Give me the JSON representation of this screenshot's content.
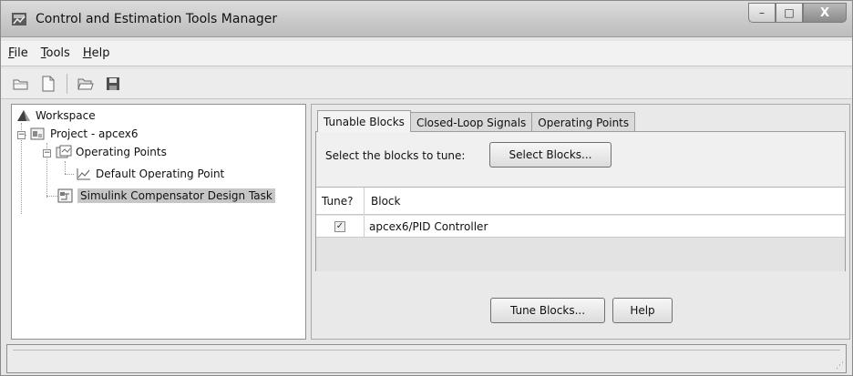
{
  "window": {
    "title": "Control and Estimation Tools Manager",
    "minimize": "–",
    "maximize": "□",
    "close": "X"
  },
  "menu": [
    {
      "label": "File",
      "accel": "F",
      "rest": "ile"
    },
    {
      "label": "Tools",
      "accel": "T",
      "rest": "ools"
    },
    {
      "label": "Help",
      "accel": "H",
      "rest": "elp"
    }
  ],
  "toolbar": {
    "icons": [
      "open-project-icon",
      "new-document-icon",
      "open-folder-icon",
      "save-icon"
    ]
  },
  "tree": {
    "workspace": "Workspace",
    "project": "Project - apcex6",
    "operating_points": "Operating Points",
    "default_op": "Default Operating Point",
    "task": "Simulink Compensator Design Task"
  },
  "tabs": {
    "tunable": "Tunable Blocks",
    "closed_loop": "Closed-Loop Signals",
    "operating": "Operating Points"
  },
  "tunable": {
    "select_label": "Select the blocks to tune:",
    "select_button": "Select Blocks...",
    "col_tune": "Tune?",
    "col_block": "Block",
    "rows": [
      {
        "checked": true,
        "check_glyph": "✓",
        "block": "apcex6/PID Controller"
      }
    ]
  },
  "buttons": {
    "tune": "Tune Blocks...",
    "help": "Help"
  },
  "colors": {
    "selection": "#c6c6c6",
    "window_bg": "#e6e6e6"
  }
}
